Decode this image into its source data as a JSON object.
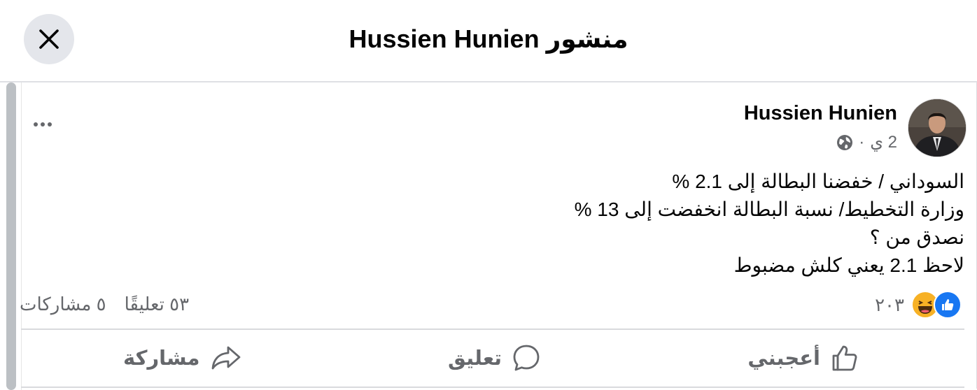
{
  "header": {
    "title": "منشور Hussien Hunien",
    "close_icon": "close-icon"
  },
  "post": {
    "author": "Hussien Hunien",
    "time": "2 ي",
    "separator": "·",
    "privacy_icon": "globe-icon",
    "more_icon": "more-options-icon",
    "lines": [
      "السوداني / خفضنا البطالة إلى 2.1 %",
      "وزارة التخطيط/ نسبة البطالة انخفضت إلى 13 %",
      "نصدق من ؟",
      "لاحظ 2.1 يعني كلش مضبوط"
    ]
  },
  "stats": {
    "reactions_count": "٢٠٣",
    "reaction_icons": [
      "like-reaction-icon",
      "haha-reaction-icon"
    ],
    "comments": "٥٣ تعليقًا",
    "shares": "٥ مشاركات"
  },
  "actions": {
    "like": "أعجبني",
    "comment": "تعليق",
    "share": "مشاركة"
  },
  "colors": {
    "accent": "#1877f2",
    "haha": "#f7b125",
    "secondary_text": "#65676b"
  }
}
